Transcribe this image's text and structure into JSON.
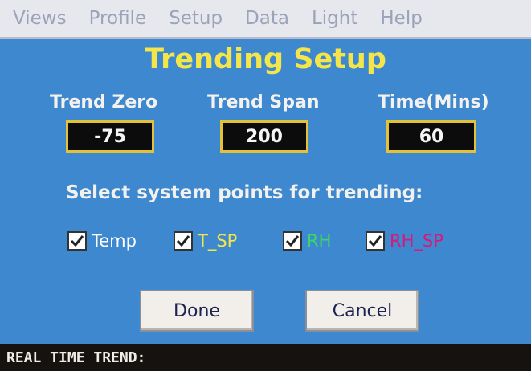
{
  "menu": [
    "Views",
    "Profile",
    "Setup",
    "Data",
    "Light",
    "Help"
  ],
  "title": "Trending Setup",
  "fields": {
    "trend_zero": {
      "label": "Trend Zero",
      "value": "-75"
    },
    "trend_span": {
      "label": "Trend Span",
      "value": "200"
    },
    "time": {
      "label": "Time(Mins)",
      "value": "60"
    }
  },
  "select_label": "Select system points for trending:",
  "points": [
    {
      "label": "Temp",
      "checked": true,
      "color": "#ffffff"
    },
    {
      "label": "T_SP",
      "checked": true,
      "color": "#f4e64a"
    },
    {
      "label": "RH",
      "checked": true,
      "color": "#3ed46a"
    },
    {
      "label": "RH_SP",
      "checked": true,
      "color": "#d8187c"
    }
  ],
  "buttons": {
    "done": "Done",
    "cancel": "Cancel"
  },
  "footer": "REAL TIME TREND:"
}
